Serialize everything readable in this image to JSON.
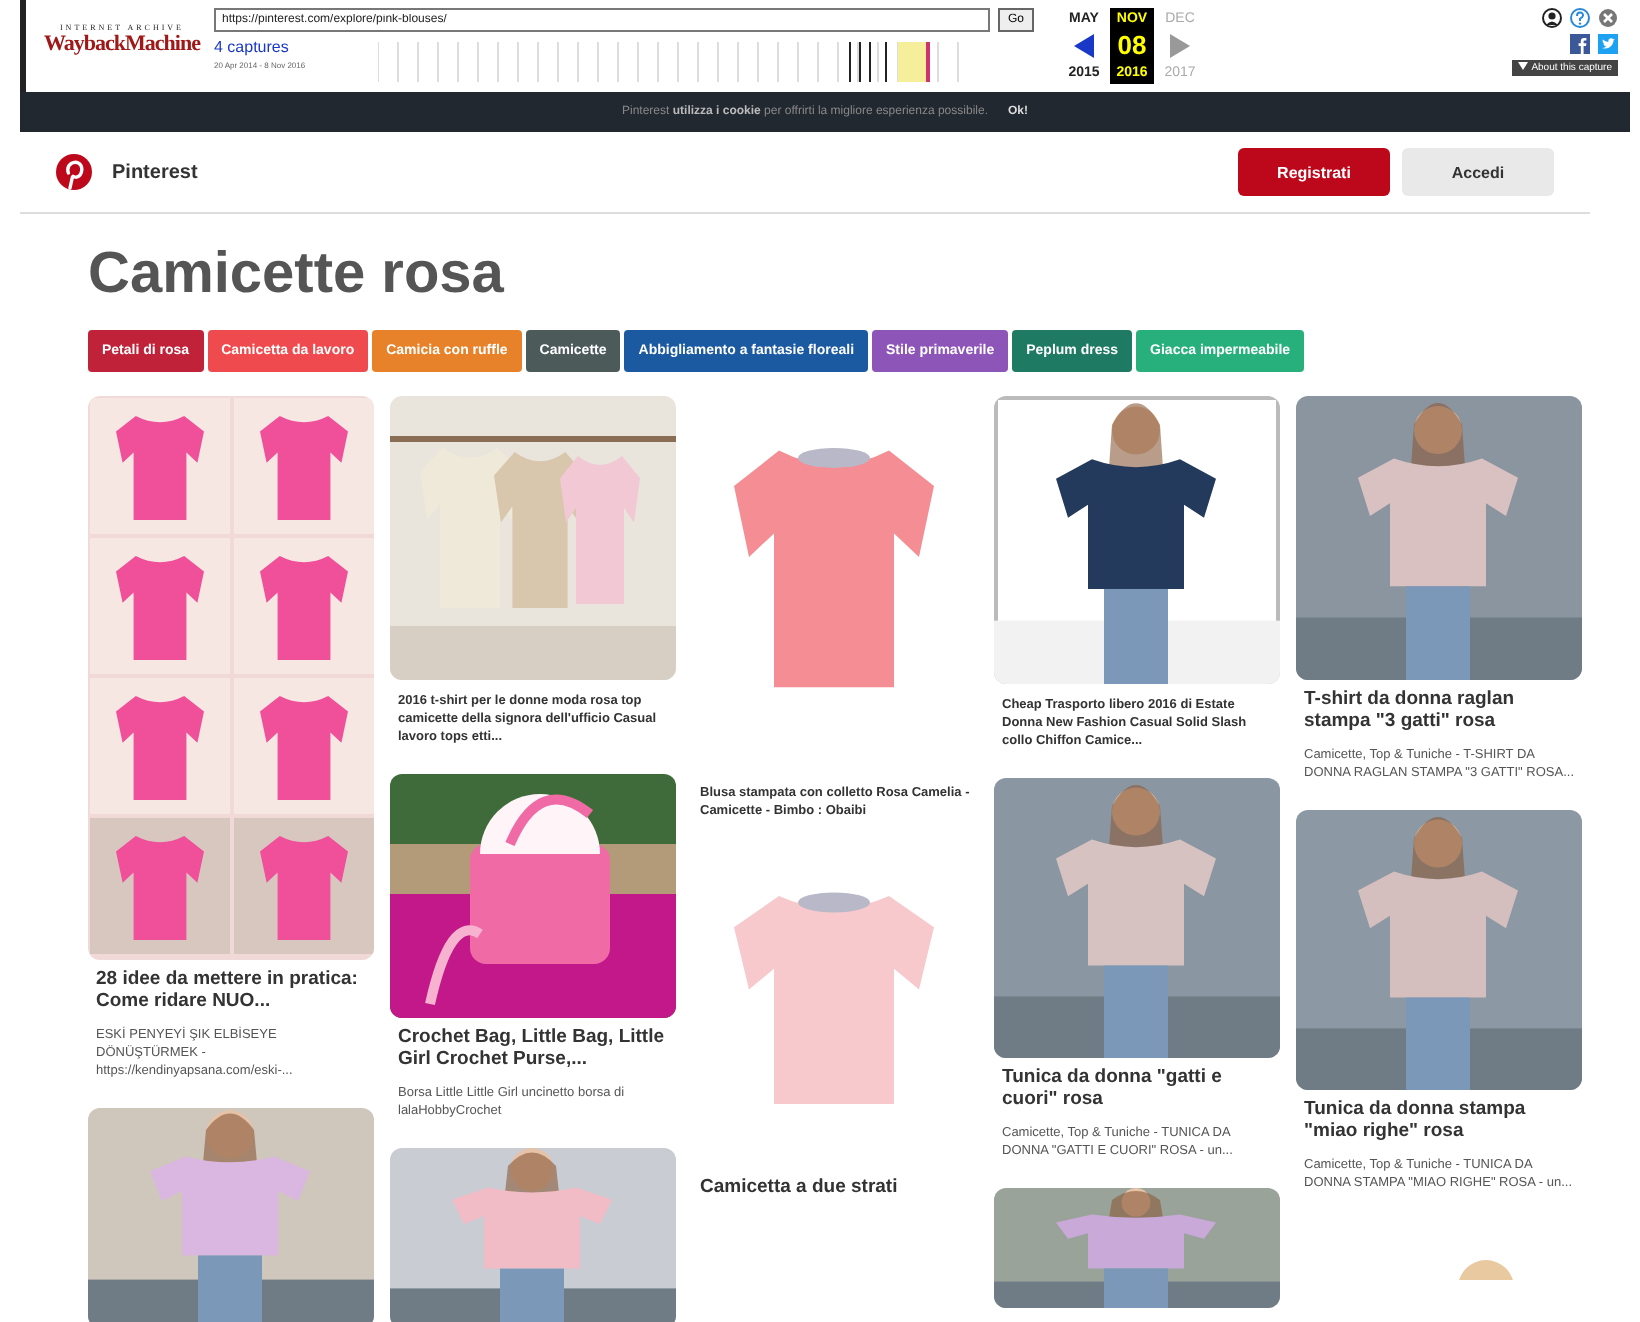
{
  "wayback": {
    "logo_top": "INTERNET ARCHIVE",
    "logo": "WaybackMachine",
    "url": "https://pinterest.com/explore/pink-blouses/",
    "go": "Go",
    "captures": "4 captures",
    "range": "20 Apr 2014 - 8 Nov 2016",
    "months": [
      {
        "label": "MAY",
        "selected": false
      },
      {
        "label": "NOV",
        "selected": true
      },
      {
        "label": "DEC",
        "selected": false
      }
    ],
    "day": "08",
    "years": [
      "2015",
      "2016",
      "2017"
    ],
    "about": "About this capture"
  },
  "cookie_bar": {
    "text": "Pinterest **utilizza i cookie** per offrirti la migliore esperienza possibile.",
    "ok": "Ok!"
  },
  "header": {
    "brand": "Pinterest",
    "signup": "Registrati",
    "login": "Accedi"
  },
  "title": "Camicette rosa",
  "tags": [
    {
      "label": "Petali di rosa",
      "color": "#c0223a"
    },
    {
      "label": "Camicetta da lavoro",
      "color": "#ef4b4f"
    },
    {
      "label": "Camicia con ruffle",
      "color": "#e8822a"
    },
    {
      "label": "Camicette",
      "color": "#4d5a5a"
    },
    {
      "label": "Abbigliamento a fantasie floreali",
      "color": "#1b5aa0"
    },
    {
      "label": "Stile primaverile",
      "color": "#8e55b8"
    },
    {
      "label": "Peplum dress",
      "color": "#1f7a63"
    },
    {
      "label": "Giacca impermeabile",
      "color": "#27b07b"
    }
  ],
  "columns": [
    {
      "pins": [
        {
          "image": {
            "kind": "picture"
          },
          "kind": "titled",
          "title": "28 idee da mettere in pratica: Come ridare NUO...",
          "description": "ESKİ PENYEYİ ŞIK ELBİSEYE DÖNÜŞTÜRMEK - https://kendinyapsana.com/eski-..."
        },
        {
          "image": {
            "kind": "picture"
          }
        }
      ]
    },
    {
      "pins": [
        {
          "image": {
            "kind": "picture"
          },
          "kind": "caption",
          "title": "2016 t-shirt per le donne moda rosa top camicette della signora dell'ufficio Casual lavoro tops etti..."
        },
        {
          "image": {
            "kind": "picture"
          },
          "kind": "titled",
          "title": "Crochet Bag, Little Bag, Little Girl Crochet Purse,...",
          "description": "Borsa Little Little Girl uncinetto borsa di lalaHobbyCrochet"
        },
        {
          "image": {
            "kind": "picture"
          }
        }
      ]
    },
    {
      "pins": [
        {
          "image": {
            "kind": "picture"
          },
          "kind": "caption",
          "title": "Blusa stampata con colletto Rosa Camelia - Camicette - Bimbo : Obaibi"
        },
        {
          "image": {
            "kind": "picture"
          },
          "kind": "titled",
          "title": "Camicetta a due strati"
        }
      ]
    },
    {
      "pins": [
        {
          "image": {
            "kind": "picture"
          },
          "kind": "caption",
          "title": "Cheap Trasporto libero 2016 di Estate Donna New Fashion Casual Solid Slash collo Chiffon Camice..."
        },
        {
          "image": {
            "kind": "picture"
          },
          "kind": "titled",
          "title": "Tunica da donna \"gatti e cuori\" rosa",
          "description": "Camicette, Top & Tuniche - TUNICA DA DONNA \"GATTI E CUORI\" ROSA - un..."
        },
        {
          "image": {
            "kind": "picture"
          }
        }
      ]
    },
    {
      "pins": [
        {
          "image": {
            "kind": "picture"
          },
          "kind": "titled",
          "title": "T-shirt da donna raglan stampa \"3 gatti\" rosa",
          "description": "Camicette, Top & Tuniche - T-SHIRT DA DONNA RAGLAN STAMPA \"3 GATTI\" ROSA..."
        },
        {
          "image": {
            "kind": "picture"
          },
          "kind": "titled",
          "title": "Tunica da donna stampa \"miao righe\" rosa",
          "description": "Camicette, Top & Tuniche - TUNICA DA DONNA STAMPA \"MIAO RIGHE\" ROSA - un..."
        },
        {
          "image": {
            "kind": "picture"
          }
        }
      ]
    }
  ]
}
